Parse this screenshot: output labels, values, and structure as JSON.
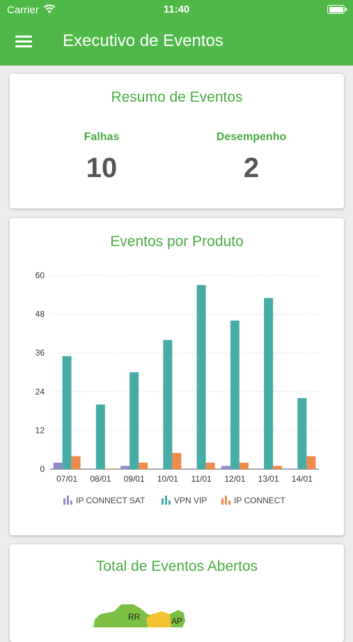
{
  "status_bar": {
    "carrier": "Carrier",
    "time": "11:40"
  },
  "app_bar": {
    "title": "Executivo de Eventos"
  },
  "summary": {
    "title": "Resumo de Eventos",
    "metrics": [
      {
        "label": "Falhas",
        "value": "10"
      },
      {
        "label": "Desempenho",
        "value": "2"
      }
    ]
  },
  "products_card": {
    "title": "Eventos por Produto"
  },
  "open_events": {
    "title": "Total de Eventos Abertos",
    "map_labels": [
      "RR",
      "AP"
    ]
  },
  "colors": {
    "brand": "#4fb848",
    "title_green": "#4aab43",
    "ip_connect_sat": "#8d8cc9",
    "vpn_vip": "#47aca6",
    "ip_connect": "#ee8a4b"
  },
  "chart_data": {
    "type": "bar",
    "categories": [
      "07/01",
      "08/01",
      "09/01",
      "10/01",
      "11/01",
      "12/01",
      "13/01",
      "14/01"
    ],
    "series": [
      {
        "name": "IP CONNECT SAT",
        "values": [
          2,
          0,
          1,
          0,
          0,
          1,
          0,
          0
        ]
      },
      {
        "name": "VPN VIP",
        "values": [
          35,
          20,
          30,
          40,
          57,
          46,
          53,
          22
        ]
      },
      {
        "name": "IP CONNECT",
        "values": [
          4,
          0,
          2,
          5,
          2,
          2,
          1,
          4
        ]
      }
    ],
    "yticks": [
      0,
      12,
      24,
      36,
      48,
      60
    ],
    "ylim": [
      0,
      60
    ],
    "grid": true,
    "legend": "bottom"
  }
}
